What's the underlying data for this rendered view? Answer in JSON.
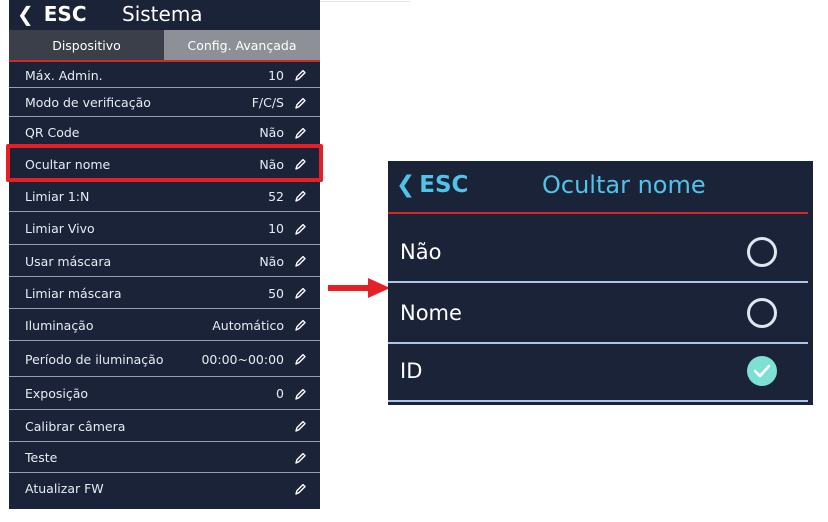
{
  "left_screen": {
    "back_label": "ESC",
    "title": "Sistema",
    "tabs": [
      {
        "label": "Dispositivo",
        "active": false
      },
      {
        "label": "Config. Avançada",
        "active": true
      }
    ],
    "rows": [
      {
        "label": "Máx. Admin.",
        "value": "10"
      },
      {
        "label": "Modo de verificação",
        "value": "F/C/S"
      },
      {
        "label": "QR Code",
        "value": "Não"
      },
      {
        "label": "Ocultar nome",
        "value": "Não"
      },
      {
        "label": "Limiar 1:N",
        "value": "52"
      },
      {
        "label": "Limiar Vivo",
        "value": "10"
      },
      {
        "label": "Usar máscara",
        "value": "Não"
      },
      {
        "label": "Limiar máscara",
        "value": "50"
      },
      {
        "label": "Iluminação",
        "value": "Automático"
      },
      {
        "label": "Período de iluminação",
        "value": "00:00~00:00"
      },
      {
        "label": "Exposição",
        "value": "0"
      },
      {
        "label": "Calibrar câmera",
        "value": ""
      },
      {
        "label": "Teste",
        "value": ""
      },
      {
        "label": "Atualizar FW",
        "value": ""
      }
    ],
    "highlighted_row": "Ocultar nome"
  },
  "right_screen": {
    "back_label": "ESC",
    "title": "Ocultar nome",
    "options": [
      {
        "label": "Não",
        "selected": false
      },
      {
        "label": "Nome",
        "selected": false
      },
      {
        "label": "ID",
        "selected": true
      }
    ]
  },
  "colors": {
    "panel_bg": "#1b2338",
    "accent_red": "#e41f25",
    "accent_cyan": "#4fc3e8",
    "check_green": "#7ee0d4"
  }
}
